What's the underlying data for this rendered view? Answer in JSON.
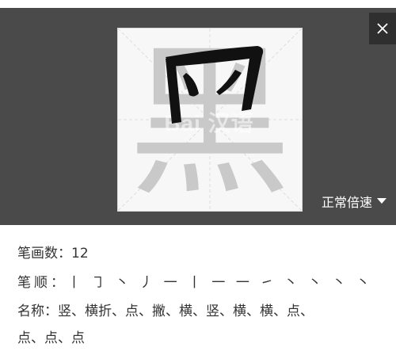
{
  "player": {
    "character": "黑",
    "watermark": "Bai 汉语",
    "speed_label": "正常倍速"
  },
  "info": {
    "stroke_count_label": "笔画数：",
    "stroke_count_value": "12",
    "order_label": "笔顺：",
    "order_strokes": "丨 ㇆ 丶 丿 一 丨 一 一 ㇀ 丶 丶 丶 丶",
    "name_label": "名称：",
    "names_line1": "竖、横折、点、撇、横、竖、横、横、点、",
    "names_line2": "点、点、点"
  }
}
